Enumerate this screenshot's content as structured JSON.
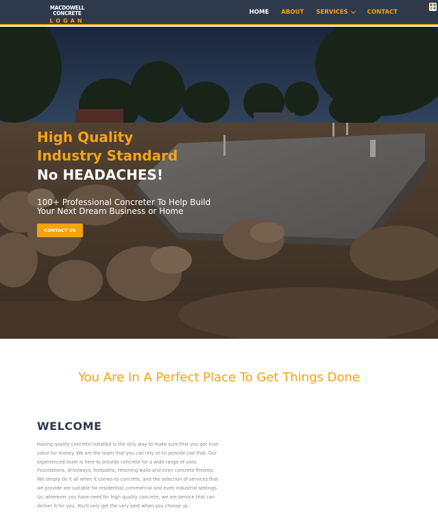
{
  "header": {
    "logo_line1": "MACDOWELL CONCRETE",
    "logo_line2": "LOGAN",
    "nav": [
      {
        "label": "HOME"
      },
      {
        "label": "ABOUT"
      },
      {
        "label": "SERVICES"
      },
      {
        "label": "CONTACT"
      }
    ]
  },
  "hero": {
    "headline_1": "High Quality",
    "headline_2": "Industry Standard",
    "headline_3": "No HEADACHES!",
    "subtitle": "100+ Professional Concreter To Help Build Your Next Dream Business or Home",
    "button_label": "CONTACT US"
  },
  "tagline": "You Are In A Perfect Place To Get Things Done",
  "welcome": {
    "title": "WELCOME",
    "body": "Having quality concrete installed is the only way to make sure that you get true value for money. We are the team that you can rely on to provide just that. Our experienced team is here to provide concrete for a wide range of uses. Foundations, driveways, footpaths, retaining walls and even concrete finishes. We simply do it all when it comes to concrete, and the selection of services that we provide are suitable for residential, commercial and even industrial settings. So, wherever you have need for high quality concrete, we are service that can deliver it for you. You'll only get the very best when you choose us."
  },
  "colors": {
    "header_bg": "#2e3a4b",
    "accent": "#f5a30c",
    "heading_dark": "#2e3a4b",
    "body_text": "#8a8a8a"
  }
}
